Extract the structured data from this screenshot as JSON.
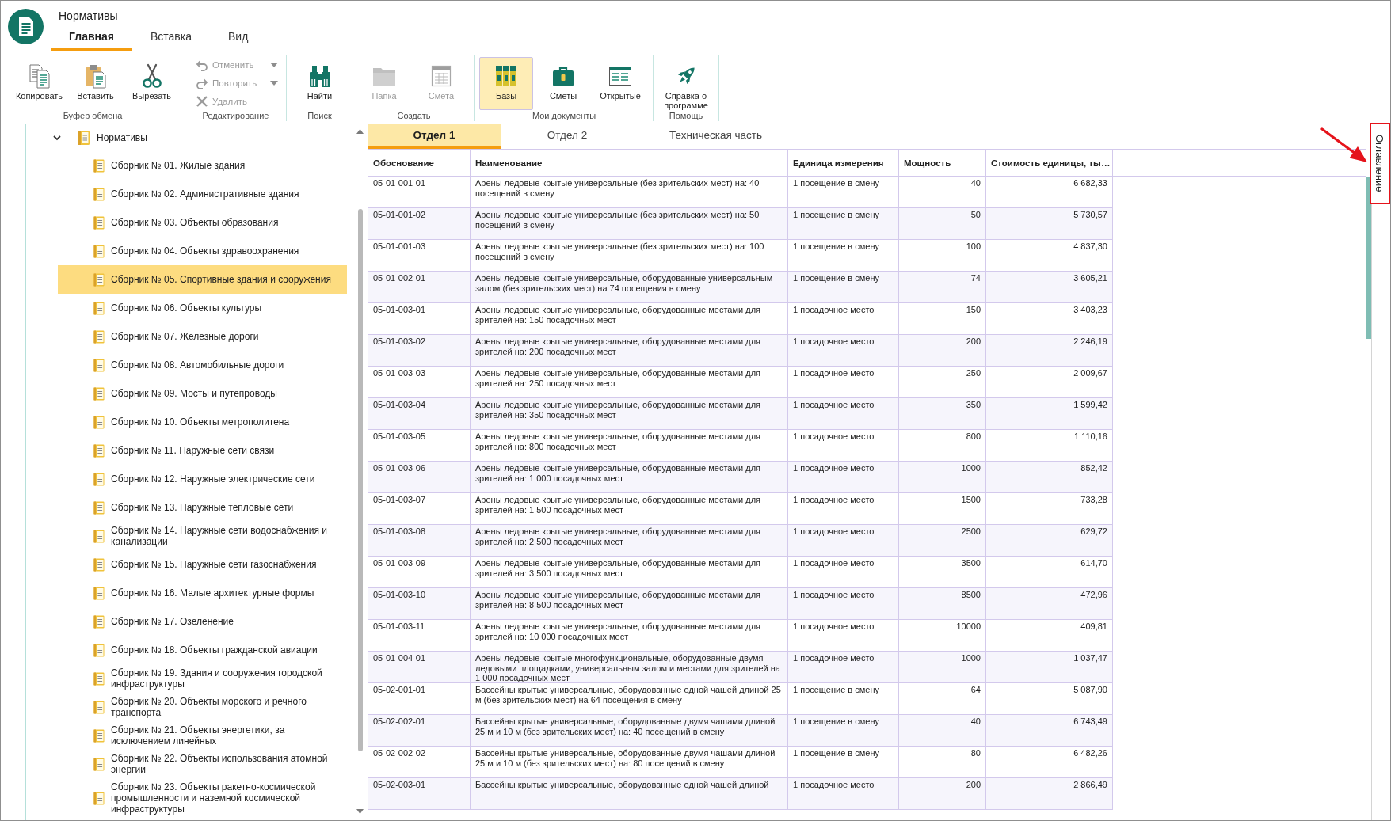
{
  "title_bar": {
    "title": "Нормативы"
  },
  "menu_tabs": [
    {
      "label": "Главная",
      "selected": true
    },
    {
      "label": "Вставка",
      "selected": false
    },
    {
      "label": "Вид",
      "selected": false
    }
  ],
  "ribbon": {
    "groups": [
      {
        "label": "Буфер обмена",
        "items": [
          {
            "kind": "large",
            "label": "Копировать",
            "disabled": false
          },
          {
            "kind": "large",
            "label": "Вставить",
            "disabled": false
          },
          {
            "kind": "large",
            "label": "Вырезать",
            "disabled": false
          }
        ]
      },
      {
        "label": "Редактирование",
        "items": [
          {
            "kind": "small",
            "label": "Отменить",
            "disabled": true,
            "dropdown": true
          },
          {
            "kind": "small",
            "label": "Повторить",
            "disabled": true,
            "dropdown": true
          },
          {
            "kind": "small",
            "label": "Удалить",
            "disabled": true,
            "dropdown": false
          }
        ]
      },
      {
        "label": "Поиск",
        "items": [
          {
            "kind": "large",
            "label": "Найти",
            "disabled": false
          }
        ]
      },
      {
        "label": "Создать",
        "items": [
          {
            "kind": "large",
            "label": "Папка",
            "disabled": true
          },
          {
            "kind": "large",
            "label": "Смета",
            "disabled": true
          }
        ]
      },
      {
        "label": "Мои документы",
        "items": [
          {
            "kind": "large",
            "label": "Базы",
            "disabled": false,
            "selected": true
          },
          {
            "kind": "large",
            "label": "Сметы",
            "disabled": false,
            "selected": false
          },
          {
            "kind": "large",
            "label": "Открытые",
            "disabled": false,
            "selected": false
          }
        ]
      },
      {
        "label": "Помощь",
        "items": [
          {
            "kind": "large",
            "label": "Справка о программе",
            "disabled": false
          }
        ]
      }
    ]
  },
  "tree": {
    "label": "Нормативы",
    "expanded": true,
    "selected": false,
    "children": [
      {
        "label": "Сборник № 01. Жилые здания",
        "selected": false
      },
      {
        "label": "Сборник № 02. Административные здания",
        "selected": false
      },
      {
        "label": "Сборник № 03. Объекты образования",
        "selected": false
      },
      {
        "label": "Сборник № 04. Объекты здравоохранения",
        "selected": false
      },
      {
        "label": "Сборник № 05. Спортивные здания и сооружения",
        "selected": true
      },
      {
        "label": "Сборник № 06. Объекты культуры",
        "selected": false
      },
      {
        "label": "Сборник № 07. Железные дороги",
        "selected": false
      },
      {
        "label": "Сборник № 08. Автомобильные дороги",
        "selected": false
      },
      {
        "label": "Сборник № 09. Мосты и путепроводы",
        "selected": false
      },
      {
        "label": "Сборник № 10. Объекты метрополитена",
        "selected": false
      },
      {
        "label": "Сборник № 11. Наружные сети связи",
        "selected": false
      },
      {
        "label": "Сборник № 12. Наружные электрические сети",
        "selected": false
      },
      {
        "label": "Сборник № 13. Наружные тепловые сети",
        "selected": false
      },
      {
        "label": "Сборник № 14. Наружные сети водоснабжения и канализации",
        "selected": false
      },
      {
        "label": "Сборник № 15. Наружные сети газоснабжения",
        "selected": false
      },
      {
        "label": "Сборник № 16. Малые архитектурные формы",
        "selected": false
      },
      {
        "label": "Сборник № 17. Озеленение",
        "selected": false
      },
      {
        "label": "Сборник № 18. Объекты гражданской авиации",
        "selected": false
      },
      {
        "label": "Сборник № 19. Здания и сооружения городской инфраструктуры",
        "selected": false
      },
      {
        "label": "Сборник № 20. Объекты морского и речного транспорта",
        "selected": false
      },
      {
        "label": "Сборник № 21. Объекты энергетики, за исключением линейных",
        "selected": false
      },
      {
        "label": "Сборник № 22. Объекты использования атомной энергии",
        "selected": false
      },
      {
        "label": "Сборник № 23. Объекты ракетно-космической промышленности и наземной космической инфраструктуры",
        "selected": false
      }
    ]
  },
  "content_tabs": [
    {
      "label": "Отдел 1",
      "selected": true
    },
    {
      "label": "Отдел 2",
      "selected": false
    },
    {
      "label": "Техническая часть",
      "selected": false
    }
  ],
  "table": {
    "columns": [
      "Обоснование",
      "Наименование",
      "Единица измерения",
      "Мощность",
      "Стоимость единицы, ты…"
    ],
    "rows": [
      [
        "05-01-001-01",
        "Арены ледовые крытые универсальные (без зрительских мест) на: 40 посещений в смену",
        "1 посещение в смену",
        "40",
        "6 682,33"
      ],
      [
        "05-01-001-02",
        "Арены ледовые крытые универсальные (без зрительских мест) на: 50 посещений в смену",
        "1 посещение в смену",
        "50",
        "5 730,57"
      ],
      [
        "05-01-001-03",
        "Арены ледовые крытые универсальные (без зрительских мест) на: 100 посещений в смену",
        "1 посещение в смену",
        "100",
        "4 837,30"
      ],
      [
        "05-01-002-01",
        "Арены ледовые крытые универсальные, оборудованные универсальным залом (без зрительских мест) на 74 посещения в смену",
        "1 посещение в смену",
        "74",
        "3 605,21"
      ],
      [
        "05-01-003-01",
        "Арены ледовые крытые универсальные, оборудованные местами для зрителей на: 150 посадочных мест",
        "1 посадочное место",
        "150",
        "3 403,23"
      ],
      [
        "05-01-003-02",
        "Арены ледовые крытые универсальные, оборудованные местами для зрителей на: 200 посадочных мест",
        "1 посадочное место",
        "200",
        "2 246,19"
      ],
      [
        "05-01-003-03",
        "Арены ледовые крытые универсальные, оборудованные местами для зрителей на: 250 посадочных мест",
        "1 посадочное место",
        "250",
        "2 009,67"
      ],
      [
        "05-01-003-04",
        "Арены ледовые крытые универсальные, оборудованные местами для зрителей на: 350 посадочных мест",
        "1 посадочное место",
        "350",
        "1 599,42"
      ],
      [
        "05-01-003-05",
        "Арены ледовые крытые универсальные, оборудованные местами для зрителей на: 800 посадочных мест",
        "1 посадочное место",
        "800",
        "1 110,16"
      ],
      [
        "05-01-003-06",
        "Арены ледовые крытые универсальные, оборудованные местами для зрителей на: 1 000 посадочных мест",
        "1 посадочное место",
        "1000",
        "852,42"
      ],
      [
        "05-01-003-07",
        "Арены ледовые крытые универсальные, оборудованные местами для зрителей на: 1 500 посадочных мест",
        "1 посадочное место",
        "1500",
        "733,28"
      ],
      [
        "05-01-003-08",
        "Арены ледовые крытые универсальные, оборудованные местами для зрителей на: 2 500 посадочных мест",
        "1 посадочное место",
        "2500",
        "629,72"
      ],
      [
        "05-01-003-09",
        "Арены ледовые крытые универсальные, оборудованные местами для зрителей на: 3 500 посадочных мест",
        "1 посадочное место",
        "3500",
        "614,70"
      ],
      [
        "05-01-003-10",
        "Арены ледовые крытые универсальные, оборудованные местами для зрителей на: 8 500 посадочных мест",
        "1 посадочное место",
        "8500",
        "472,96"
      ],
      [
        "05-01-003-11",
        "Арены ледовые крытые универсальные, оборудованные местами для зрителей на: 10 000 посадочных мест",
        "1 посадочное место",
        "10000",
        "409,81"
      ],
      [
        "05-01-004-01",
        "Арены ледовые крытые многофункциональные, оборудованные двумя ледовыми площадками, универсальным залом и местами для зрителей на 1 000 посадочных мест",
        "1 посадочное место",
        "1000",
        "1 037,47"
      ],
      [
        "05-02-001-01",
        "Бассейны крытые универсальные, оборудованные одной чашей длиной 25 м (без зрительских мест) на 64 посещения в смену",
        "1 посещение в смену",
        "64",
        "5 087,90"
      ],
      [
        "05-02-002-01",
        "Бассейны крытые универсальные, оборудованные двумя чашами длиной 25 м и 10 м (без зрительских мест) на: 40 посещений в смену",
        "1 посещение в смену",
        "40",
        "6 743,49"
      ],
      [
        "05-02-002-02",
        "Бассейны крытые универсальные, оборудованные двумя чашами длиной 25 м и 10 м (без зрительских мест) на: 80 посещений в смену",
        "1 посещение в смену",
        "80",
        "6 482,26"
      ],
      [
        "05-02-003-01",
        "Бассейны крытые универсальные, оборудованные одной чашей длиной",
        "1 посадочное место",
        "200",
        "2 866,49"
      ]
    ]
  },
  "side_panel": {
    "label": "Оглавление",
    "highlighted": true
  }
}
